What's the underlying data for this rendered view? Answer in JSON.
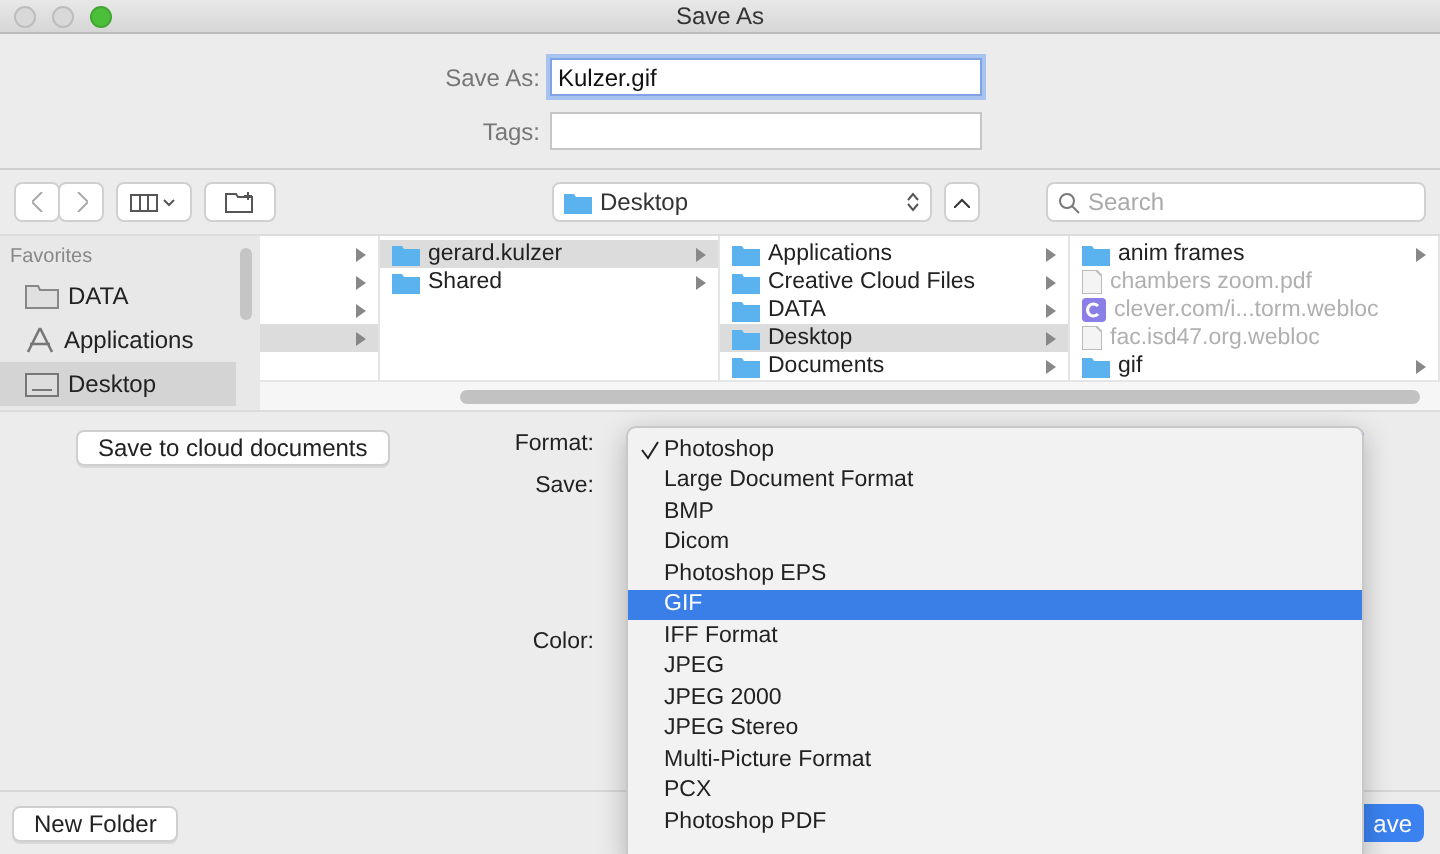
{
  "window": {
    "title": "Save As"
  },
  "form": {
    "save_as_label": "Save As:",
    "save_as_value": "Kulzer.gif",
    "tags_label": "Tags:"
  },
  "toolbar": {
    "location": "Desktop",
    "search_placeholder": "Search"
  },
  "sidebar": {
    "heading": "Favorites",
    "items": [
      {
        "label": "DATA",
        "kind": "drive",
        "selected": false
      },
      {
        "label": "Applications",
        "kind": "apps",
        "selected": false
      },
      {
        "label": "Desktop",
        "kind": "desktop",
        "selected": true
      }
    ]
  },
  "columns": [
    {
      "items": [
        {
          "kind": "blank",
          "selected": false,
          "has_children": true
        },
        {
          "kind": "blank",
          "selected": false,
          "has_children": true
        },
        {
          "kind": "blank",
          "selected": false,
          "has_children": true
        },
        {
          "kind": "blank",
          "selected": true,
          "has_children": true
        }
      ]
    },
    {
      "items": [
        {
          "label": "gerard.kulzer",
          "kind": "folder",
          "selected": true,
          "has_children": true,
          "disabled": false
        },
        {
          "label": "Shared",
          "kind": "folder",
          "selected": false,
          "has_children": true,
          "disabled": false
        }
      ]
    },
    {
      "items": [
        {
          "label": "Applications",
          "kind": "folder",
          "selected": false,
          "has_children": true,
          "disabled": false
        },
        {
          "label": "Creative Cloud Files",
          "kind": "folder",
          "selected": false,
          "has_children": true,
          "disabled": false
        },
        {
          "label": "DATA",
          "kind": "folder",
          "selected": false,
          "has_children": true,
          "disabled": false
        },
        {
          "label": "Desktop",
          "kind": "folder",
          "selected": true,
          "has_children": true,
          "disabled": false
        },
        {
          "label": "Documents",
          "kind": "folder",
          "selected": false,
          "has_children": true,
          "disabled": false
        }
      ]
    },
    {
      "items": [
        {
          "label": "anim frames",
          "kind": "folder",
          "selected": false,
          "has_children": true,
          "disabled": false
        },
        {
          "label": "chambers zoom.pdf",
          "kind": "file",
          "selected": false,
          "has_children": false,
          "disabled": true
        },
        {
          "label": "clever.com/i...torm.webloc",
          "kind": "link",
          "selected": false,
          "has_children": false,
          "disabled": true
        },
        {
          "label": "fac.isd47.org.webloc",
          "kind": "file",
          "selected": false,
          "has_children": false,
          "disabled": true
        },
        {
          "label": "gif",
          "kind": "folder",
          "selected": false,
          "has_children": true,
          "disabled": false
        }
      ]
    }
  ],
  "options": {
    "cloud_button": "Save to cloud documents",
    "format_label": "Format:",
    "save_label": "Save:",
    "color_label": "Color:"
  },
  "format_menu": [
    {
      "label": "Photoshop",
      "checked": true,
      "selected": false
    },
    {
      "label": "Large Document Format",
      "checked": false,
      "selected": false
    },
    {
      "label": "BMP",
      "checked": false,
      "selected": false
    },
    {
      "label": "Dicom",
      "checked": false,
      "selected": false
    },
    {
      "label": "Photoshop EPS",
      "checked": false,
      "selected": false
    },
    {
      "label": "GIF",
      "checked": false,
      "selected": true
    },
    {
      "label": "IFF Format",
      "checked": false,
      "selected": false
    },
    {
      "label": "JPEG",
      "checked": false,
      "selected": false
    },
    {
      "label": "JPEG 2000",
      "checked": false,
      "selected": false
    },
    {
      "label": "JPEG Stereo",
      "checked": false,
      "selected": false
    },
    {
      "label": "Multi-Picture Format",
      "checked": false,
      "selected": false
    },
    {
      "label": "PCX",
      "checked": false,
      "selected": false
    },
    {
      "label": "Photoshop PDF",
      "checked": false,
      "selected": false
    }
  ],
  "footer": {
    "new_folder": "New Folder",
    "save": "ave"
  }
}
